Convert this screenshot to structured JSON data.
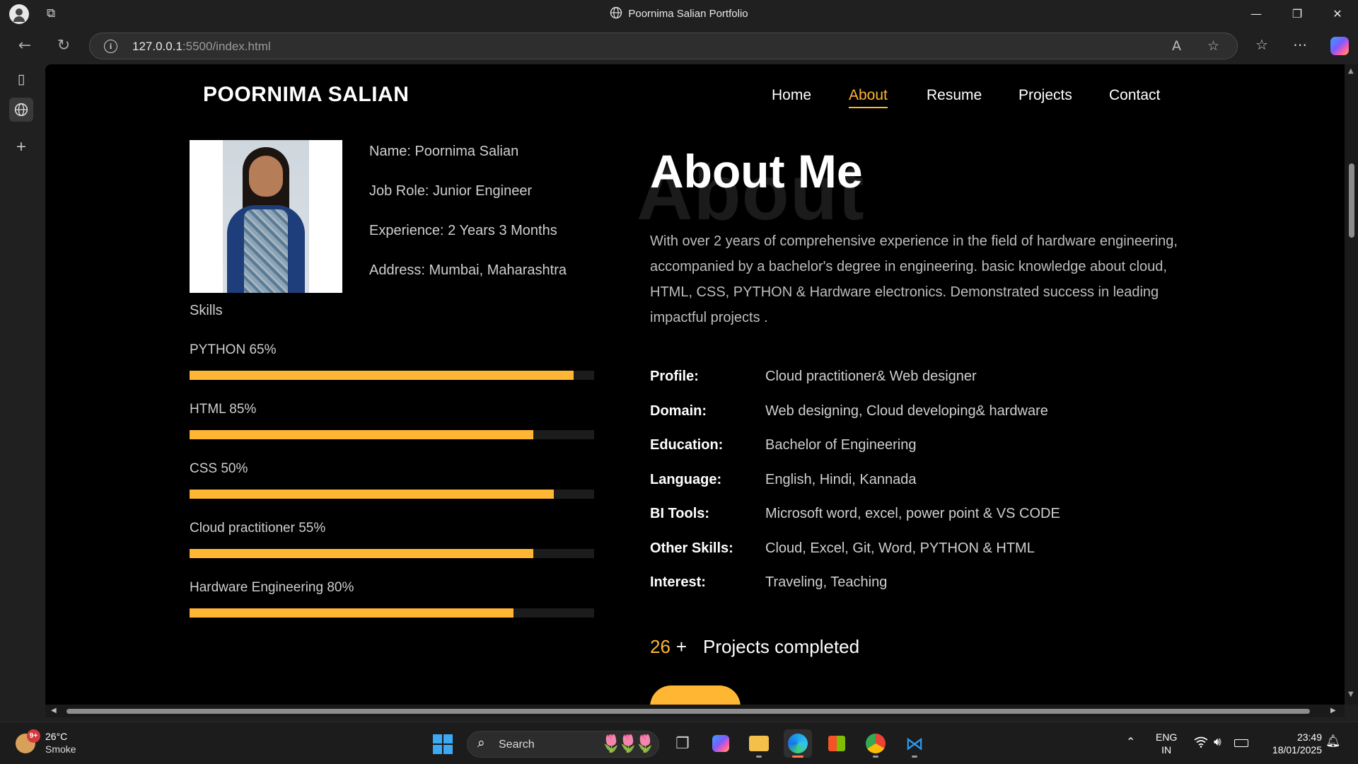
{
  "browser": {
    "tab_title": "Poornima Salian Portfolio",
    "url_host": "127.0.0.1",
    "url_rest": ":5500/index.html"
  },
  "nav": {
    "brand": "POORNIMA SALIAN",
    "links": [
      "Home",
      "About",
      "Resume",
      "Projects",
      "Contact"
    ],
    "active": "About"
  },
  "profile": {
    "name": "Name: Poornima Salian",
    "job_role": "Job Role: Junior Engineer",
    "experience": "Experience: 2 Years 3 Months",
    "address": "Address: Mumbai, Maharashtra"
  },
  "skills": {
    "title": "Skills",
    "items": [
      {
        "label": "PYTHON 65%",
        "fill": 0.95
      },
      {
        "label": "HTML 85%",
        "fill": 0.85
      },
      {
        "label": "CSS 50%",
        "fill": 0.9
      },
      {
        "label": "Cloud practitioner 55%",
        "fill": 0.85
      },
      {
        "label": "Hardware Engineering 80%",
        "fill": 0.8
      }
    ]
  },
  "about": {
    "bg_word": "About",
    "title": "About Me",
    "text": "With over 2 years of comprehensive experience in the field of hardware engineering, accompanied by a bachelor's degree in engineering. basic knowledge about cloud, HTML, CSS, PYTHON & Hardware electronics. Demonstrated success in leading impactful projects .",
    "details": [
      {
        "key": "Profile:",
        "value": "Cloud practitioner& Web designer"
      },
      {
        "key": "Domain:",
        "value": "Web designing, Cloud developing& hardware"
      },
      {
        "key": "Education:",
        "value": "Bachelor of Engineering"
      },
      {
        "key": "Language:",
        "value": "English, Hindi, Kannada"
      },
      {
        "key": "BI Tools:",
        "value": "Microsoft word, excel, power point & VS CODE"
      },
      {
        "key": "Other Skills:",
        "value": "Cloud, Excel, Git, Word, PYTHON & HTML"
      },
      {
        "key": "Interest:",
        "value": "Traveling, Teaching"
      }
    ],
    "counter_value": "26",
    "counter_plus": "+",
    "counter_label": "Projects completed"
  },
  "accent_color": "#ffb633",
  "taskbar": {
    "weather_badge": "9+",
    "temperature": "26°C",
    "condition": "Smoke",
    "search_label": "Search",
    "lang_top": "ENG",
    "lang_bottom": "IN",
    "time": "23:49",
    "date": "18/01/2025"
  }
}
